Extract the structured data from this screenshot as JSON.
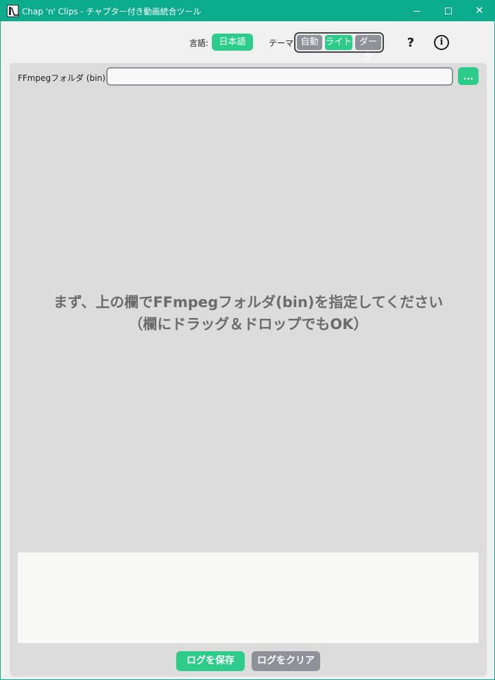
{
  "window": {
    "title": "Chap 'n' Clips - チャプター付き動画統合ツール",
    "minimize_symbol": "",
    "maximize_symbol": "",
    "close_symbol": "✕"
  },
  "header": {
    "language_label": "言語:",
    "language_value": "日本語",
    "theme_label": "テーマ:",
    "theme_options": [
      "自動",
      "ライト",
      "ダーク"
    ],
    "theme_selected": "ライト",
    "help_symbol": "?",
    "info_symbol": "i"
  },
  "ffmpeg": {
    "label": "FFmpegフォルダ (bin):",
    "value": "",
    "browse_label": "..."
  },
  "main": {
    "hint_line1": "まず、上の欄でFFmpegフォルダ(bin)を指定してください",
    "hint_line2": "（欄にドラッグ＆ドロップでもOK）"
  },
  "log": {
    "content": "",
    "save_label": "ログを保存",
    "clear_label": "ログをクリア"
  },
  "colors": {
    "titlebar": "#0bab8e",
    "accent": "#2ecc8a",
    "inactive": "#8e9197",
    "panel": "#dcdcdc"
  }
}
